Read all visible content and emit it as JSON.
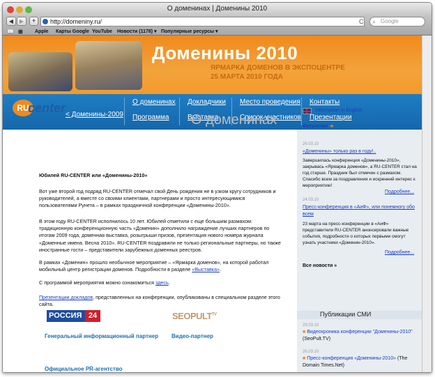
{
  "window": {
    "title": "О доменинах | Доменины 2010"
  },
  "toolbar": {
    "url": "http://domeniny.ru/",
    "search_placeholder": "Google",
    "back": "◀",
    "forward": "▶",
    "add": "+",
    "reload": "C"
  },
  "bookmarks": [
    {
      "label": "Apple"
    },
    {
      "label": "Карты Google"
    },
    {
      "label": "YouTube"
    },
    {
      "label": "Новости (1178) ▾"
    },
    {
      "label": "Популярные ресурсы ▾"
    }
  ],
  "banner": {
    "title": "Доменины 2010",
    "subtitle_line1": "ЯРМАРКА ДОМЕНОВ В ЭКСПОЦЕНТРЕ",
    "subtitle_line2": "25 МАРТА 2010 ГОДА"
  },
  "nav": {
    "prev": "< Доменины-2009",
    "items": [
      "О доменинах",
      "Докладчики",
      "Место проведения",
      "Контакты",
      "Программа",
      "Выставка",
      "Список участников",
      "Презентации"
    ]
  },
  "logo": {
    "ru": "RU",
    "center": "center"
  },
  "page_title": "О доменинах",
  "article": {
    "heading": "Юбилей RU-CENTER или «Доменины-2010»",
    "p1": "Вот уже второй год подряд RU-CENTER отмечал свой День рождения не в узком кругу сотрудников и руководителей, а вместе со своими клиентами, партнерами и просто интересующимися пользователями Рунета – в рамках праздничной конференции «Доменины-2010».",
    "p2": "В этом году RU-CENTER исполнилось 10 лет. Юбилей отметили с еще большим размахом: традиционную конференционную часть «Доменин» дополнило награждение лучших партнеров по итогам 2009 года, доменная выставка, розыгрыши призов, презентация нового номера журнала «Доменные имена. Весна 2010». RU-CENTER поздравили не только региональные партнеры, но также иностранные гости – представители зарубежных доменных реестров.",
    "p3_a": "В рамках «Доменин» прошло необычное мероприятие – «Ярмарка доменов», на которой работал мобильный центр регистрации доменов. Подробности в разделе ",
    "p3_link": "«Выставка»",
    "p3_b": ".",
    "p4_a": "С программой мероприятия можно ознакомиться ",
    "p4_link": "здесь",
    "p4_b": ".",
    "p5_link": "Презентации докладов",
    "p5_b": ", представленных на конференции, опубликованы в специальном разделе этого сайта."
  },
  "partners": {
    "general_label": "Генеральный информационный партнер",
    "video_label": "Видео-партнер",
    "pr_label": "Официальное PR-агентство",
    "rossiya": "РОССИЯ",
    "r24": "24",
    "seopult": "SEOPULT",
    "seopult_tv": "TV"
  },
  "sidebar": {
    "english": "Information in English",
    "photoreport": "Фотоотчет",
    "news": [
      {
        "date": "26.03.10",
        "title": "«Доменины» только раз в году!..",
        "text": "Завершилась конференция «Доменины-2010», закрывась «Ярмарка доменов», а RU-CENTER стал на год старше. Праздник был отмечен с размахом. Спасибо всем за поздравления и искренний интерес к мероприятию!",
        "more": "Подробнее..."
      },
      {
        "date": "24.03.10",
        "title": "Пресс-конференция в «АиФ», или понемногу обо всем",
        "text": "23 марта на пресс-конференции в «АиФ» представители RU-CENTER анонсировали важные события, подробности о которых первыми смогут узнать участники «Доменин-2010».",
        "more": "Подробнее..."
      }
    ],
    "all_news": "Все новости »",
    "media_heading": "Публикации СМИ",
    "media": [
      {
        "date": "29.03.10",
        "link": "Видеохроника конференции \"Доменины-2010\"",
        "source": "(SeoPult.TV)"
      },
      {
        "date": "26.03.10",
        "link": "Пресс-конференция «Доменины-2010»",
        "source": "(The Domain Times.Net)"
      }
    ]
  }
}
